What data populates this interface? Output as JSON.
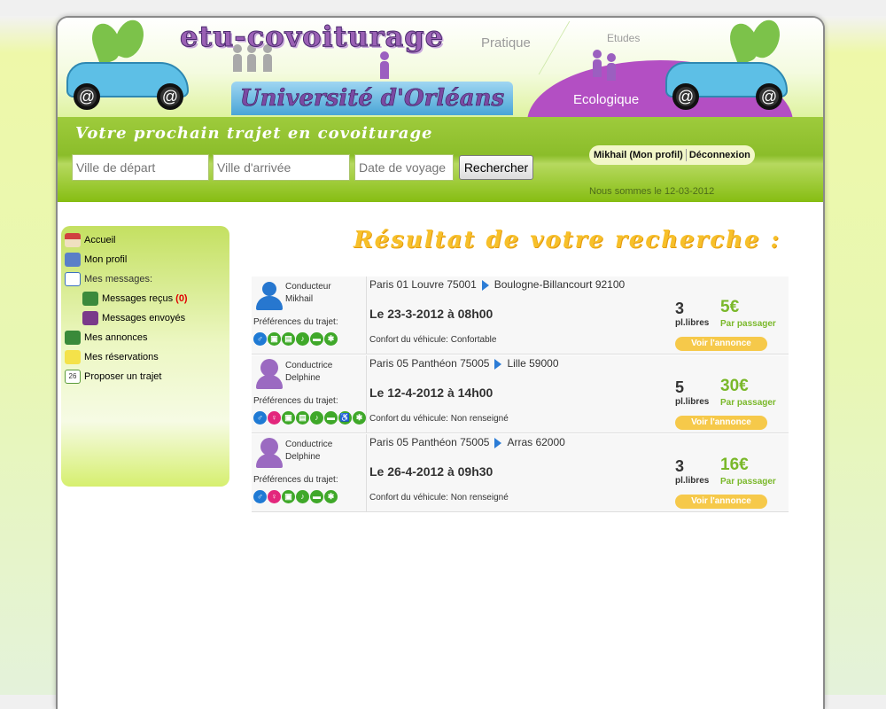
{
  "header": {
    "site_logo": "etu-covoiturage",
    "university": "Université d'Orléans",
    "tag_pratique": "Pratique",
    "tag_etudes": "Etudes",
    "tag_ecologique": "Ecologique"
  },
  "search": {
    "title": "Votre prochain trajet en covoiturage",
    "departure_placeholder": "Ville de départ",
    "arrival_placeholder": "Ville d'arrivée",
    "date_placeholder": "Date de voyage",
    "button_label": "Rechercher"
  },
  "user": {
    "profile_link": "Mikhail (Mon profil)",
    "logout": "Déconnexion",
    "date_line": "Nous sommes le 12-03-2012"
  },
  "sidebar": {
    "home": "Accueil",
    "profile": "Mon profil",
    "messages_heading": "Mes messages:",
    "messages_received": "Messages reçus",
    "unread_count": "(0)",
    "messages_sent": "Messages envoyés",
    "my_ads": "Mes annonces",
    "my_bookings": "Mes réservations",
    "propose_trip": "Proposer un trajet",
    "calendar_day": "26"
  },
  "results": {
    "title": "Résultat de votre recherche :",
    "prefs_label": "Préférences du trajet:",
    "seats_label": "pl.libres",
    "price_label": "Par passager",
    "view_label": "Voir l'annonce",
    "items": [
      {
        "role": "Conducteur",
        "name": "Mikhail",
        "from": "Paris 01 Louvre 75001",
        "to": "Boulogne-Billancourt 92100",
        "date": "Le 23-3-2012 à 08h00",
        "comfort": "Confort du véhicule: Confortable",
        "seats": "3",
        "price": "5€"
      },
      {
        "role": "Conductrice",
        "name": "Delphine",
        "from": "Paris 05 Panthéon 75005",
        "to": "Lille 59000",
        "date": "Le 12-4-2012 à 14h00",
        "comfort": "Confort du véhicule: Non renseigné",
        "seats": "5",
        "price": "30€"
      },
      {
        "role": "Conductrice",
        "name": "Delphine",
        "from": "Paris 05 Panthéon 75005",
        "to": "Arras 62000",
        "date": "Le 26-4-2012 à 09h30",
        "comfort": "Confort du véhicule: Non renseigné",
        "seats": "3",
        "price": "16€"
      }
    ]
  },
  "colors": {
    "accent_green": "#7ab82a",
    "title_orange": "#f7c02a",
    "button_yellow": "#f6c94a"
  }
}
